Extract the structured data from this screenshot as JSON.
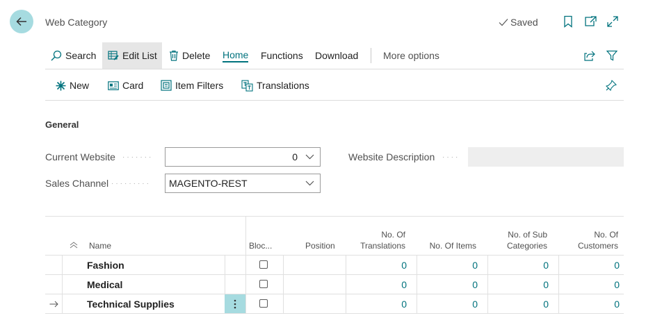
{
  "header": {
    "title": "Web Category",
    "saved_label": "Saved"
  },
  "actions": {
    "search": "Search",
    "edit_list": "Edit List",
    "delete": "Delete",
    "home": "Home",
    "functions": "Functions",
    "download": "Download",
    "more_options": "More options"
  },
  "subactions": {
    "new": "New",
    "card": "Card",
    "item_filters": "Item Filters",
    "translations": "Translations"
  },
  "general": {
    "title": "General",
    "current_website_label": "Current Website",
    "current_website_value": "0",
    "sales_channel_label": "Sales Channel",
    "sales_channel_value": "MAGENTO-REST",
    "website_description_label": "Website Description",
    "website_description_value": ""
  },
  "grid": {
    "columns": {
      "name": "Name",
      "blocked": "Bloc...",
      "position": "Position",
      "no_translations_1": "No. Of",
      "no_translations_2": "Translations",
      "no_items": "No. Of Items",
      "no_sub_1": "No. of Sub",
      "no_sub_2": "Categories",
      "no_customers_1": "No. Of",
      "no_customers_2": "Customers"
    },
    "rows": [
      {
        "name": "Fashion",
        "blocked": false,
        "position": "",
        "translations": "0",
        "items": "0",
        "sub_categories": "0",
        "customers": "0"
      },
      {
        "name": "Medical",
        "blocked": false,
        "position": "",
        "translations": "0",
        "items": "0",
        "sub_categories": "0",
        "customers": "0"
      },
      {
        "name": "Technical Supplies",
        "blocked": false,
        "position": "",
        "translations": "0",
        "items": "0",
        "sub_categories": "0",
        "customers": "0"
      }
    ]
  },
  "colors": {
    "accent": "#00727d",
    "back_button_bg": "#a6dbe0"
  },
  "icons": [
    "back-arrow-icon",
    "checkmark-icon",
    "bookmark-icon",
    "open-new-window-icon",
    "expand-icon",
    "search-icon",
    "edit-list-icon",
    "delete-icon",
    "share-icon",
    "filter-icon",
    "new-icon",
    "card-icon",
    "item-filters-icon",
    "translations-icon",
    "pin-icon",
    "collapse-icon",
    "row-arrow-icon",
    "more-dots-icon",
    "chevron-down-icon"
  ]
}
